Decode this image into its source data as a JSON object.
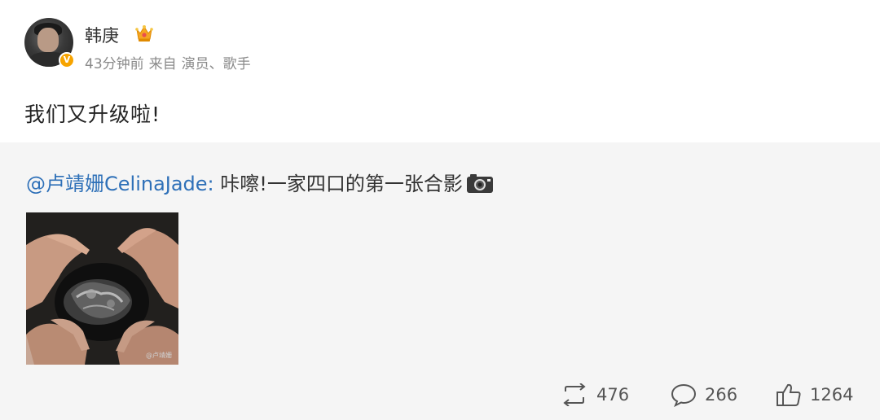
{
  "author": {
    "name": "韩庚",
    "time": "43分钟前",
    "source_prefix": "来自",
    "source": "演员、歌手",
    "verified_icon": "verified-v-icon",
    "member_icon": "crown-icon"
  },
  "post": {
    "text": "我们又升级啦!"
  },
  "repost": {
    "mention": "@卢靖姗CelinaJade:",
    "text": " 咔嚓!一家四口的第一张合影",
    "emoji": "camera-icon",
    "image_watermark": "@卢靖姗"
  },
  "actions": {
    "repost_count": "476",
    "comment_count": "266",
    "like_count": "1264"
  },
  "colors": {
    "link": "#2e70b8",
    "repost_bg": "#f5f5f5",
    "verified": "#f7a400"
  }
}
